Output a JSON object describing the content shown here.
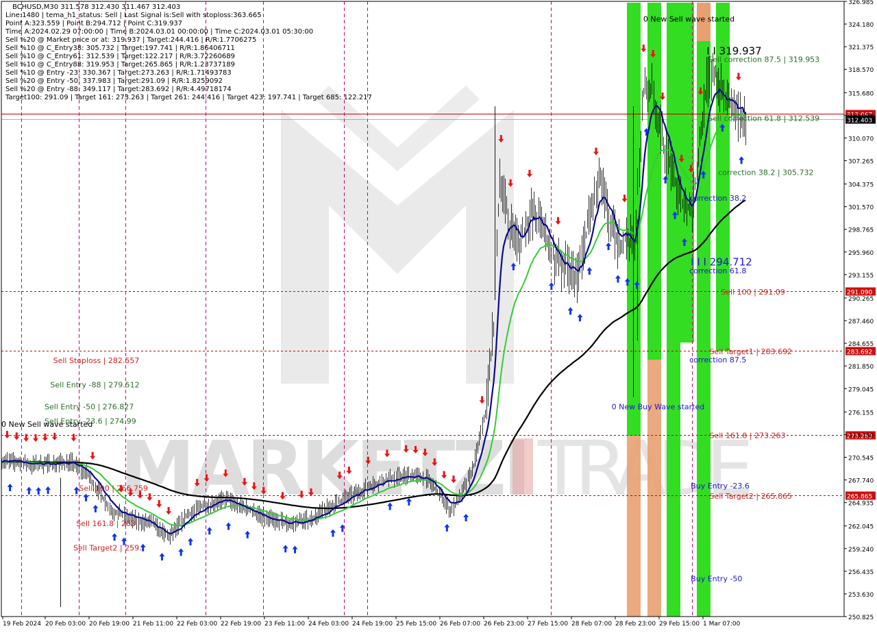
{
  "window": {
    "symbol_line": "BCHUSD,M30  311.578 312.430 311.467 312.403"
  },
  "info_panel": [
    "Line:1480  | tema_h1_status: Sell  | Last Signal is:Sell with stoploss:363.665",
    "Point A:323.559  | Point B:294.712  | Point C:319.937",
    "Time A:2024.02.29 07:00:00  | Time B:2024.03.01 00:00:00  | Time C:2024.03.01 05:30:00",
    "Sell %20 @ Market price or at: 319.937  | Target:244.416  | R/R:1.7706275",
    "Sell %10 @ C_Entry38: 305.732  | Target:197.741  | R/R:1.86406711",
    "Sell %10 @ C_Entry61: 312.539  | Target:122.217  | R/R:3.72260689",
    "Sell %10 @ C_Entry88: 319.953  | Target:265.865  | R/R:1.23737189",
    "Sell %10 @ Entry -23: 330.367  | Target:273.263  | R/R:1.71493783",
    "Sell %20 @ Entry -50: 337.983  | Target:291.09  | R/R:1.8259092",
    "Sell %20 @ Entry -88: 349.117  | Target:283.692  | R/R:4.49718174",
    "Target100: 291.09  | Target 161: 273.263  | Target 261: 244.416  | Target 423: 197.741  | Target 685: 122.217"
  ],
  "watermark": {
    "left": "MARKETZI",
    "right": "TRADE"
  },
  "colors": {
    "price_bar": "#000000",
    "fast_ma": "#0a0a8c",
    "slow_ma": "#33cc33",
    "long_ma": "#000000",
    "zone_green": "#33dd22",
    "zone_orange": "#e8a070",
    "hline_red": "#cc0000",
    "vline_magenta": "#c0007a",
    "label_red": "#cc2222",
    "label_green": "#2a6e2a",
    "label_blue": "#1a1ad0",
    "arrow_red": "#ee1111",
    "arrow_blue": "#1133ee"
  },
  "chart_data": {
    "type": "candlestick",
    "symbol": "BCHUSD",
    "timeframe": "M30",
    "ohlc_last": {
      "open": 311.578,
      "high": 312.43,
      "low": 311.467,
      "close": 312.403
    },
    "ylim": [
      250.825,
      326.985
    ],
    "y_ticks": [
      "326.985",
      "324.180",
      "321.375",
      "318.570",
      "315.680",
      "312.875",
      "310.070",
      "307.265",
      "304.375",
      "301.570",
      "298.765",
      "295.960",
      "293.155",
      "290.265",
      "287.460",
      "284.655",
      "281.850",
      "279.045",
      "276.155",
      "273.350",
      "270.545",
      "267.740",
      "264.935",
      "262.045",
      "259.240",
      "256.435",
      "253.630",
      "250.825"
    ],
    "x_ticks": [
      "19 Feb 2024",
      "20 Feb 03:00",
      "20 Feb 19:00",
      "21 Feb 11:00",
      "22 Feb 03:00",
      "22 Feb 19:00",
      "23 Feb 11:00",
      "24 Feb 03:00",
      "24 Feb 19:00",
      "25 Feb 15:00",
      "26 Feb 07:00",
      "26 Feb 23:00",
      "27 Feb 15:00",
      "28 Feb 07:00",
      "28 Feb 23:00",
      "29 Feb 15:00",
      "1 Mar 07:00"
    ],
    "horizontal_levels": [
      {
        "price": 313.067,
        "tag": "313.067",
        "style": "solid"
      },
      {
        "price": 312.403,
        "tag": "312.403",
        "style": "current"
      },
      {
        "price": 291.09,
        "tag": "291.090",
        "style": "dashed"
      },
      {
        "price": 283.692,
        "tag": "283.692",
        "style": "dashed"
      },
      {
        "price": 273.263,
        "tag": "273.263",
        "style": "dashed"
      },
      {
        "price": 265.865,
        "tag": "265.865",
        "style": "dashed"
      }
    ],
    "vertical_separators_time": [
      "19 Feb 07:00",
      "20 Feb 03:00",
      "20 Feb 19:00",
      "21 Feb 23:00",
      "22 Feb 19:00",
      "23 Feb 23:00",
      "24 Feb 07:00",
      "26 Feb 23:00",
      "29 Feb 00:00"
    ],
    "annotations": [
      {
        "text": "0 New Sell wave started",
        "time": "28 Feb 07:00",
        "price": 324.5,
        "color": "black"
      },
      {
        "text": "I I 319.937",
        "time": "29 Feb 05:00",
        "price": 320.4,
        "color": "black"
      },
      {
        "text": "Sell correction 87.5 | 319.953",
        "time": "29 Feb 05:30",
        "price": 319.5,
        "color": "green"
      },
      {
        "text": "Sell correction 61.8 | 312.539",
        "time": "29 Feb 05:30",
        "price": 312.2,
        "color": "green"
      },
      {
        "text": "correction 38.2 | 305.732",
        "time": "29 Feb 09:00",
        "price": 305.5,
        "color": "green"
      },
      {
        "text": "correction 38.2",
        "time": "28 Feb 23:00",
        "price": 302.3,
        "color": "blue"
      },
      {
        "text": "I I I 294.712",
        "time": "28 Feb 23:30",
        "price": 294.3,
        "color": "blue"
      },
      {
        "text": "correction 61.8",
        "time": "28 Feb 23:00",
        "price": 293.3,
        "color": "blue"
      },
      {
        "text": "Sell 100 | 291.09",
        "time": "29 Feb 10:00",
        "price": 290.7,
        "color": "red"
      },
      {
        "text": "Sell Target1 | 283.692",
        "time": "29 Feb 06:00",
        "price": 283.3,
        "color": "red"
      },
      {
        "text": "correction 87.5",
        "time": "28 Feb 23:00",
        "price": 282.3,
        "color": "blue"
      },
      {
        "text": "0 New Buy Wave started",
        "time": "27 Feb 20:00",
        "price": 276.5,
        "color": "blue"
      },
      {
        "text": "Sell 161.8 | 273.263",
        "time": "29 Feb 06:00",
        "price": 272.9,
        "color": "red"
      },
      {
        "text": "Buy Entry -23.6",
        "time": "28 Feb 23:30",
        "price": 266.7,
        "color": "blue"
      },
      {
        "text": "Sell Target2 | 265.865",
        "time": "29 Feb 06:00",
        "price": 265.4,
        "color": "red"
      },
      {
        "text": "Buy Entry -50",
        "time": "28 Feb 23:30",
        "price": 255.2,
        "color": "blue"
      },
      {
        "text": "Sell Stoploss | 282.557",
        "time": "19 Feb 18:00",
        "price": 282.2,
        "color": "red"
      },
      {
        "text": "Sell Entry -88 | 279.512",
        "time": "19 Feb 17:00",
        "price": 279.2,
        "color": "green"
      },
      {
        "text": "Sell Entry -50 | 276.827",
        "time": "19 Feb 15:00",
        "price": 276.5,
        "color": "green"
      },
      {
        "text": "Sell Entry -23.6 | 274.99",
        "time": "19 Feb 15:00",
        "price": 274.7,
        "color": "green"
      },
      {
        "text": "0 New Sell wave started",
        "time": "19 Feb 00:00",
        "price": 274.3,
        "color": "black"
      },
      {
        "text": "Sell 100 | 266.759",
        "time": "20 Feb 03:00",
        "price": 266.4,
        "color": "red"
      },
      {
        "text": "Sell 161.8 | 263.",
        "time": "20 Feb 02:00",
        "price": 262.0,
        "color": "red"
      },
      {
        "text": "Sell Target2 | 259.",
        "time": "20 Feb 01:00",
        "price": 259.0,
        "color": "red"
      }
    ]
  }
}
